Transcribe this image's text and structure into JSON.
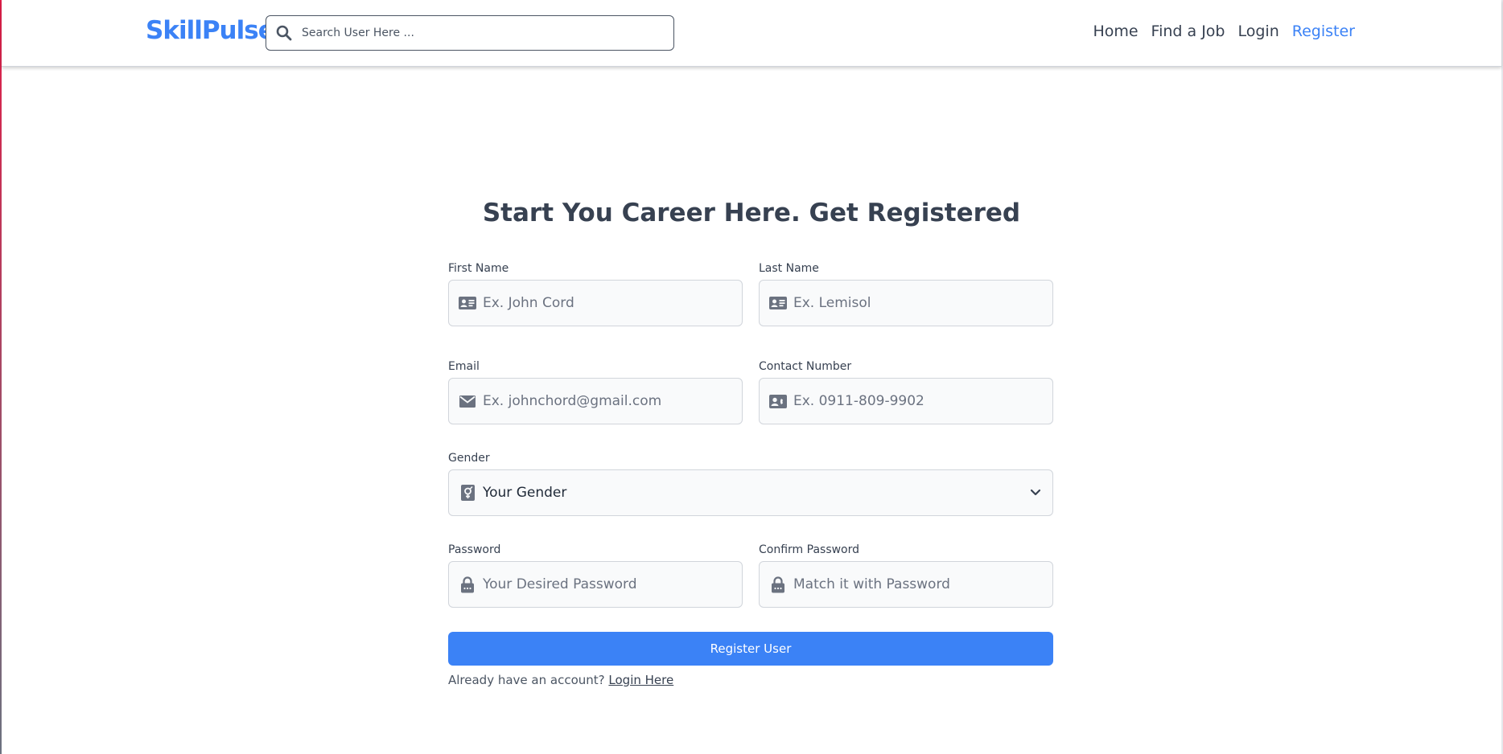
{
  "brand": {
    "name": "SkillPulse",
    "color": "#3b82f6"
  },
  "search": {
    "placeholder": "Search User Here ...",
    "icon": "search-icon"
  },
  "nav": {
    "items": [
      {
        "label": "Home",
        "active": false
      },
      {
        "label": "Find a Job",
        "active": false
      },
      {
        "label": "Login",
        "active": false
      },
      {
        "label": "Register",
        "active": true
      }
    ]
  },
  "form": {
    "title": "Start You Career Here. Get Registered",
    "first_name": {
      "label": "First Name",
      "placeholder": "Ex. John Cord",
      "icon": "id-card-icon"
    },
    "last_name": {
      "label": "Last Name",
      "placeholder": "Ex. Lemisol",
      "icon": "id-card-icon"
    },
    "email": {
      "label": "Email",
      "placeholder": "Ex. johnchord@gmail.com",
      "icon": "envelope-icon"
    },
    "contact": {
      "label": "Contact Number",
      "placeholder": "Ex. 0911-809-9902",
      "icon": "contact-card-icon"
    },
    "gender": {
      "label": "Gender",
      "selected": "Your Gender",
      "icon": "gender-icon"
    },
    "password": {
      "label": "Password",
      "placeholder": "Your Desired Password",
      "icon": "lock-icon"
    },
    "confirm_password": {
      "label": "Confirm Password",
      "placeholder": "Match it with Password",
      "icon": "lock-icon"
    },
    "submit_label": "Register User",
    "login_prompt": "Already have an account?",
    "login_link": "Login Here"
  },
  "colors": {
    "accent": "#3b82f6",
    "text": "#374151",
    "input_bg": "#f9fafb"
  }
}
